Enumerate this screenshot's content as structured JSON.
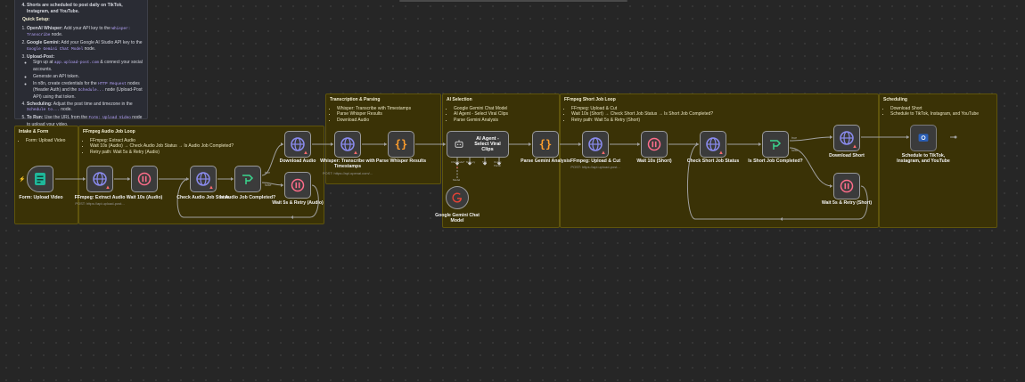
{
  "setup_note": {
    "intro_item": "Shorts are scheduled to post daily on TikTok, Instagram, and YouTube.",
    "heading": "Quick Setup:",
    "steps": [
      {
        "title": "OpenAI Whisper:",
        "text": " Add your API key to the ",
        "code": "Whisper: Transcribe",
        "suffix": " node."
      },
      {
        "title": "Google Gemini:",
        "text": " Add your Google AI Studio API key to the ",
        "code": "Google Gemini Chat Model",
        "suffix": " node."
      },
      {
        "title": "Upload-Post:",
        "text": "",
        "code": "",
        "suffix": ""
      },
      {
        "title": "Scheduling:",
        "text": " Adjust the post time and timezone in the ",
        "code": "Schedule to...",
        "suffix": " node."
      },
      {
        "title": "To Run:",
        "text": " Use the URL from the ",
        "code": "Form: Upload Video",
        "suffix": " node to upload your video."
      }
    ],
    "upload_post_items": [
      {
        "text": "Sign up at ",
        "code": "app.upload-post.com",
        "suffix": " & connect your social accounts."
      },
      {
        "text": "Generate an API token.",
        "code": "",
        "suffix": ""
      },
      {
        "text": "In n8n, create credentials for the ",
        "code": "HTTP Request",
        "suffix": " nodes (Header Auth) and the "
      },
      {
        "text": "",
        "code": "Schedule...",
        "suffix": " node (Upload-Post API) using that token."
      }
    ]
  },
  "stickies": {
    "intake": {
      "title": "Intake & Form",
      "items": [
        "Form: Upload Video"
      ]
    },
    "ffmpeg_audio": {
      "title": "FFmpeg Audio Job Loop",
      "items": [
        "FFmpeg: Extract Audio",
        "Wait 10s (Audio) → Check Audio Job Status → Is Audio Job Completed?",
        "Retry path: Wait 5s & Retry (Audio)"
      ]
    },
    "transcription": {
      "title": "Transcription & Parsing",
      "items": [
        "Whisper: Transcribe with Timestamps",
        "Parse Whisper Results",
        "Download Audio"
      ]
    },
    "ai_selection": {
      "title": "AI Selection",
      "items": [
        "Google Gemini Chat Model",
        "AI Agent - Select Viral Clips",
        "Parse Gemini Analysis"
      ]
    },
    "ffmpeg_short": {
      "title": "FFmpeg Short Job Loop",
      "items": [
        "FFmpeg: Upload & Cut",
        "Wait 10s (Short) → Check Short Job Status → Is Short Job Completed?",
        "Retry path: Wait 5s & Retry (Short)"
      ]
    },
    "scheduling": {
      "title": "Scheduling",
      "items": [
        "Download Short",
        "Schedule to TikTok, Instagram, and YouTube"
      ]
    }
  },
  "nodes": {
    "form_upload": {
      "label": "Form: Upload Video"
    },
    "ffmpeg_extract": {
      "label": "FFmpeg: Extract Audio",
      "sub": "POST: https://api.upload-post..."
    },
    "wait_audio": {
      "label": "Wait 10s (Audio)"
    },
    "check_audio": {
      "label": "Check Audio Job Status"
    },
    "is_audio": {
      "label": "Is Audio Job Completed?"
    },
    "download_audio": {
      "label": "Download Audio"
    },
    "retry_audio": {
      "label": "Wait 5s & Retry (Audio)"
    },
    "whisper": {
      "label": "Whisper: Transcribe with Timestamps",
      "sub": "POST: https://api.openai.com/..."
    },
    "parse_whisper": {
      "label": "Parse Whisper Results"
    },
    "ai_agent": {
      "label": "AI Agent - Select Viral Clips",
      "ports": [
        "Chat Model*",
        "Memory",
        "Tool",
        "Output Parser"
      ]
    },
    "gemini_model": {
      "label": "Google Gemini Chat Model",
      "port": "Model"
    },
    "parse_gemini": {
      "label": "Parse Gemini Analysis"
    },
    "ffmpeg_cut": {
      "label": "FFmpeg: Upload & Cut",
      "sub": "POST: https://api.upload-post..."
    },
    "wait_short": {
      "label": "Wait 10s (Short)"
    },
    "check_short": {
      "label": "Check Short Job Status"
    },
    "is_short": {
      "label": "Is Short Job Completed?"
    },
    "download_short": {
      "label": "Download Short"
    },
    "retry_short": {
      "label": "Wait 5s & Retry (Short)"
    },
    "schedule": {
      "label": "Schedule to TikTok, Instagram, and YouTube"
    }
  },
  "branch_labels": {
    "true": "true",
    "false": "false"
  },
  "colors": {
    "canvas": "#262626",
    "sticky": "#3a3206",
    "node_border": "#9a9a9a",
    "http_icon": "#8b8cf0",
    "wait_icon": "#ff6d8a",
    "code_icon": "#ff9e2c",
    "if_icon": "#3bd68e",
    "form_icon": "#1fb79a",
    "warning": "#ff6b6b"
  }
}
